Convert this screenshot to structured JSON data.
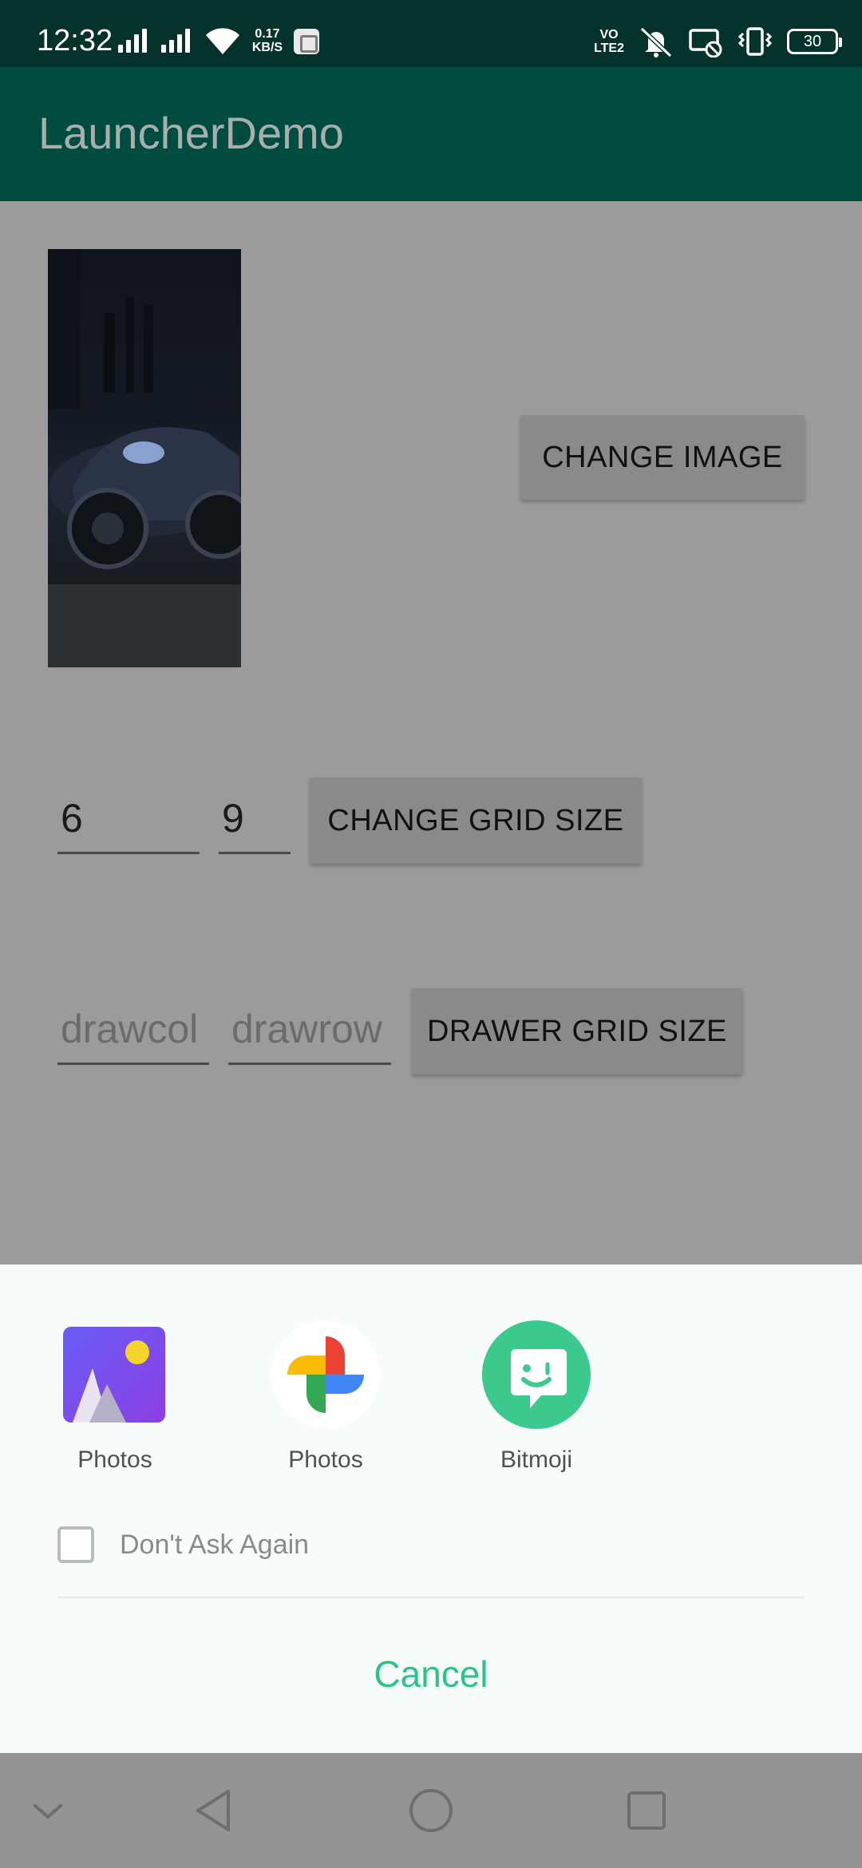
{
  "status_bar": {
    "time": "12:32",
    "network_speed": "0.17 KB/S",
    "network_speed_value": "0.17",
    "network_speed_unit": "KB/S",
    "volte_top": "VO",
    "volte_bottom": "LTE2",
    "battery": "30",
    "icons": [
      "signal-icon",
      "signal-icon",
      "wifi-icon",
      "app-notification-icon",
      "volte-icon",
      "mute-icon",
      "cast-off-icon",
      "vibrate-icon",
      "battery-icon"
    ]
  },
  "app_bar": {
    "title": "LauncherDemo"
  },
  "main": {
    "change_image_label": "CHANGE IMAGE",
    "grid_cols_value": "6",
    "grid_rows_value": "9",
    "change_grid_label": "CHANGE GRID SIZE",
    "drawer_cols_placeholder": "drawcol",
    "drawer_rows_placeholder": "drawrow",
    "drawer_grid_label": "DRAWER GRID SIZE"
  },
  "chooser": {
    "apps": [
      {
        "label": "Photos",
        "icon": "gallery-photos-icon"
      },
      {
        "label": "Photos",
        "icon": "google-photos-icon"
      },
      {
        "label": "Bitmoji",
        "icon": "bitmoji-icon"
      }
    ],
    "dont_ask_label": "Don't Ask Again",
    "dont_ask_checked": false,
    "cancel_label": "Cancel"
  },
  "nav_bar": {
    "icons": [
      "collapse-icon",
      "back-icon",
      "home-icon",
      "recents-icon"
    ]
  },
  "colors": {
    "status_bar": "#05332b",
    "app_bar": "#004c41",
    "scrim": "#9b9b9b",
    "accent": "#2bc484",
    "sheet": "#f7fcfb"
  }
}
